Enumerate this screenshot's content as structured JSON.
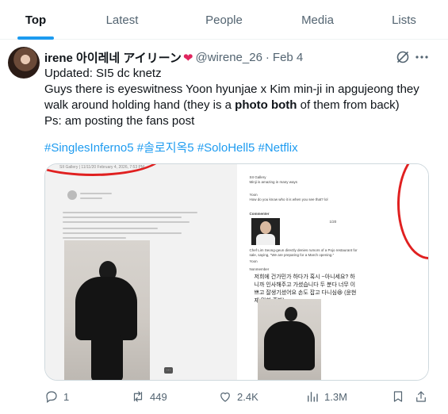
{
  "tabs": [
    {
      "label": "Top",
      "active": true
    },
    {
      "label": "Latest",
      "active": false
    },
    {
      "label": "People",
      "active": false
    },
    {
      "label": "Media",
      "active": false
    },
    {
      "label": "Lists",
      "active": false
    }
  ],
  "tweet": {
    "display_name": "irene 아이레네 アイリーン",
    "handle": "@wirene_26",
    "separator": "·",
    "date": "Feb 4",
    "lines": [
      "Updated: SI5 dc knetz",
      "Guys there is eyeswitness  Yoon hyunjae x Kim min-ji in apgujeong they",
      "Ps: am posting the fans post"
    ],
    "line2_pre": "walk around holding hand (they is a ",
    "line2_bold": "photo both",
    "line2_post": " of them  from back)",
    "hashtags": [
      "#SinglesInferno5",
      "#솔로지옥5",
      "#SoloHell5",
      "#Netflix"
    ]
  },
  "media": {
    "left_header": "SII Gallery | 11/11/20   February 4, 2026, 7:53 PM",
    "left_badge": "···",
    "right_chat": [
      "SII Gallery",
      "Minji is amazing in many ways",
      "Yoon",
      "How do you know who it is when you see that? lol",
      "Commenter",
      "Chef Lim Seong-geun directly denies rumors of a Pojo restaurant for sale, saying, \"We are preparing for a March opening.\"",
      "Yoon",
      "Nonmember",
      "1/20"
    ],
    "korean_text": "저희에 건가민가 하다가 혹시 ~아니세요? 하니까 인사해주고 가셨습니다 두 분다 너무 이쁘고 잘생기셨어요 손도 잡고 다니심😆 (윤현재 민희 혼방)"
  },
  "actions": {
    "replies": "1",
    "reposts": "449",
    "likes": "2.4K",
    "views": "1.3M"
  },
  "colors": {
    "accent": "#1d9bf0",
    "heart": "#e0245e",
    "muted": "#536471",
    "border": "#cfd9de"
  }
}
